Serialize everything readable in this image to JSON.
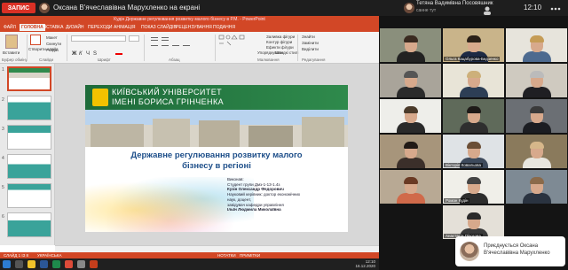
{
  "topbar": {
    "record_label": "ЗАПИС",
    "sharer_text": "Оксана В'ячеславівна Марухленко на екрані",
    "speaker_text": "Тетяна Вадимівна Посовяшник",
    "speaker_sub": "санне тут",
    "time": "12:10"
  },
  "app": {
    "window_title": "Кудін Державне регулювання розвитку малого бізнесу в Р.М. - PowerPoint",
    "tabs": [
      "ФАЙЛ",
      "ГОЛОВНА",
      "ВСТАВКА",
      "ДИЗАЙН",
      "ПЕРЕХОДИ",
      "АНІМАЦІЯ",
      "ПОКАЗ СЛАЙДІВ",
      "РЕЦЕНЗУВАННЯ",
      "ПОДАННЯ"
    ],
    "ribbon": {
      "paste": "Вставити",
      "clipboard": "Буфер обміну",
      "new_slide": "Створити слайд",
      "layout": "Макет",
      "reset": "Скинути",
      "section": "Розділ",
      "slides_group": "Слайди",
      "font_group": "Шрифт",
      "paragraph_group": "Абзац",
      "arrange": "Упорядкувати",
      "quick_styles": "Швидкі стилі",
      "drawing_group": "Малювання",
      "shape_fill": "Заливка фігури",
      "shape_outline": "Контур фігури",
      "shape_effects": "Ефекти фігури",
      "find": "Знайти",
      "replace": "Замінити",
      "select": "Виділити",
      "editing_group": "Редагування"
    },
    "slide_numbers": [
      "1",
      "2",
      "3",
      "4",
      "5",
      "6"
    ],
    "slide": {
      "university_line1": "КИЇВСЬКИЙ УНІВЕРСИТЕТ",
      "university_line2": "ІМЕНІ БОРИСА ГРІНЧЕНКА",
      "title_line1": "Державне регулювання розвитку малого",
      "title_line2": "бізнесу в регіоні",
      "info": [
        "Виконав:",
        "Студент групи Дмз-1-13-1.4з",
        "Кузін Олександр Федорович",
        "Науковий керівник: доктор економічних",
        "наук, доцент,",
        "завідувач кафедри управління",
        "Ільїн Людмила Миколаївна"
      ]
    },
    "status_left": "СЛАЙД 1 ІЗ 8",
    "status_lang": "УКРАЇНСЬКА",
    "status_notes": "НОТАТКИ",
    "status_comments": "ПРИМІТКИ",
    "status_zoom": "",
    "taskbar_time": "12:10",
    "taskbar_date": "16.12.2020"
  },
  "gallery": {
    "labels": [
      "Ольга Кацабурова-Бедзенко",
      "Вікторія Ковальова",
      "Роман Кудін",
      "Анастасія Пірогова"
    ]
  },
  "join_notice": {
    "line1": "Приєднується Оксана",
    "line2": "В'ячеславівна Марухленко"
  }
}
